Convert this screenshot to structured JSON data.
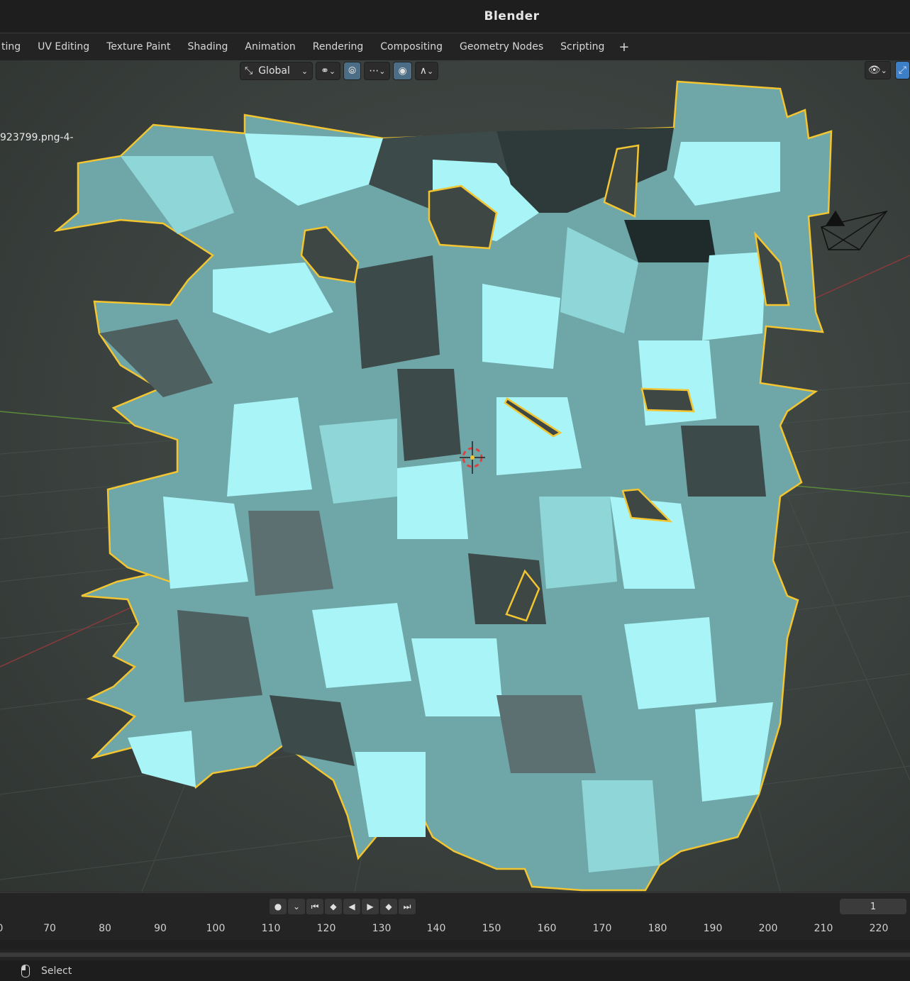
{
  "window": {
    "title": "Blender"
  },
  "tabs": [
    {
      "label": "ting"
    },
    {
      "label": "UV Editing"
    },
    {
      "label": "Texture Paint"
    },
    {
      "label": "Shading"
    },
    {
      "label": "Animation"
    },
    {
      "label": "Rendering"
    },
    {
      "label": "Compositing"
    },
    {
      "label": "Geometry Nodes"
    },
    {
      "label": "Scripting"
    }
  ],
  "tab_add": "+",
  "viewport": {
    "transform_orientation": "Global",
    "object_label": "923799.png-4-"
  },
  "timeline": {
    "current_frame": "1",
    "ticks": [
      "0",
      "70",
      "80",
      "90",
      "100",
      "110",
      "120",
      "130",
      "140",
      "150",
      "160",
      "170",
      "180",
      "190",
      "200",
      "210",
      "220"
    ]
  },
  "statusbar": {
    "select_label": "Select"
  },
  "colors": {
    "selection_outline": "#f2c531",
    "mesh_light": "#a8f4f6",
    "mesh_dark": "#3d4a4a",
    "accent_blue": "#3d7fc7"
  },
  "icons": [
    "transform-orientation-icon",
    "pivot-icon",
    "snap-icon",
    "proportional-edit-icon",
    "visibility-icon",
    "gizmo-icon",
    "camera-icon",
    "3d-cursor-icon",
    "mouse-left-icon"
  ]
}
